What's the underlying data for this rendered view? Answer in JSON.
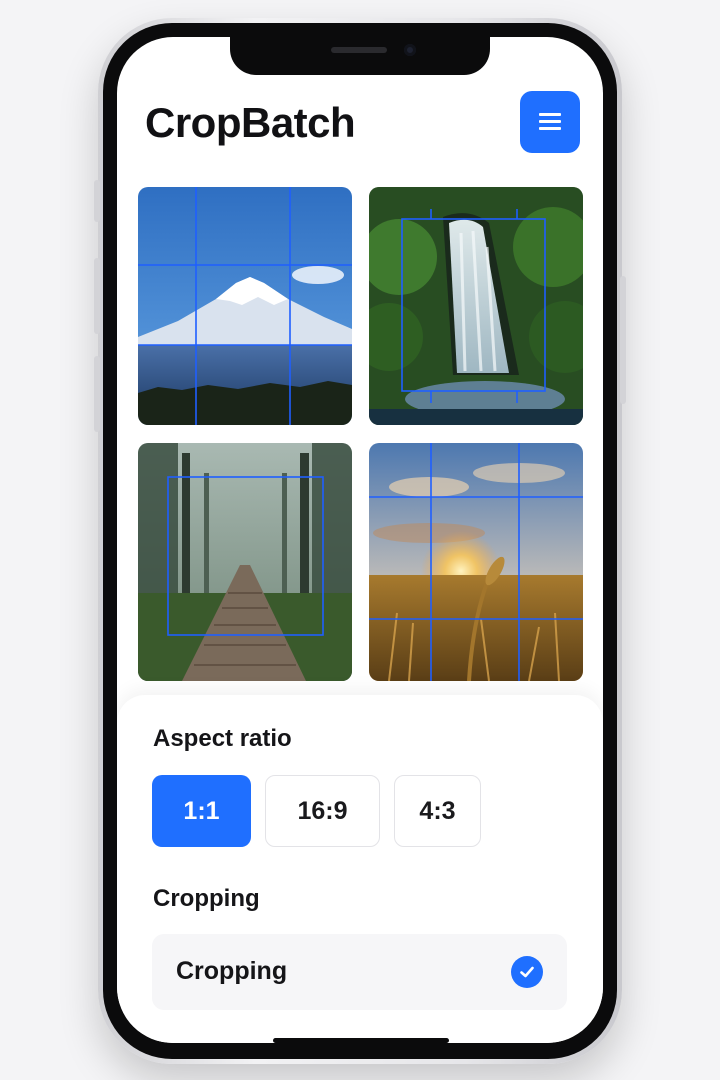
{
  "app": {
    "title": "CropBatch"
  },
  "header": {
    "menu_icon": "hamburger-menu-icon",
    "accent": "#1f6fff"
  },
  "gallery": {
    "items": [
      {
        "subject": "mountain",
        "overlay": "grid"
      },
      {
        "subject": "waterfall",
        "overlay": "crop-box"
      },
      {
        "subject": "forest-path",
        "overlay": "crop-box"
      },
      {
        "subject": "wheat-sunset",
        "overlay": "grid"
      }
    ]
  },
  "aspect": {
    "label": "Aspect ratio",
    "options": [
      "1:1",
      "16:9",
      "4:3"
    ],
    "selected": "1:1"
  },
  "cropping": {
    "label": "Cropping",
    "option_label": "Cropping",
    "checked": true
  }
}
